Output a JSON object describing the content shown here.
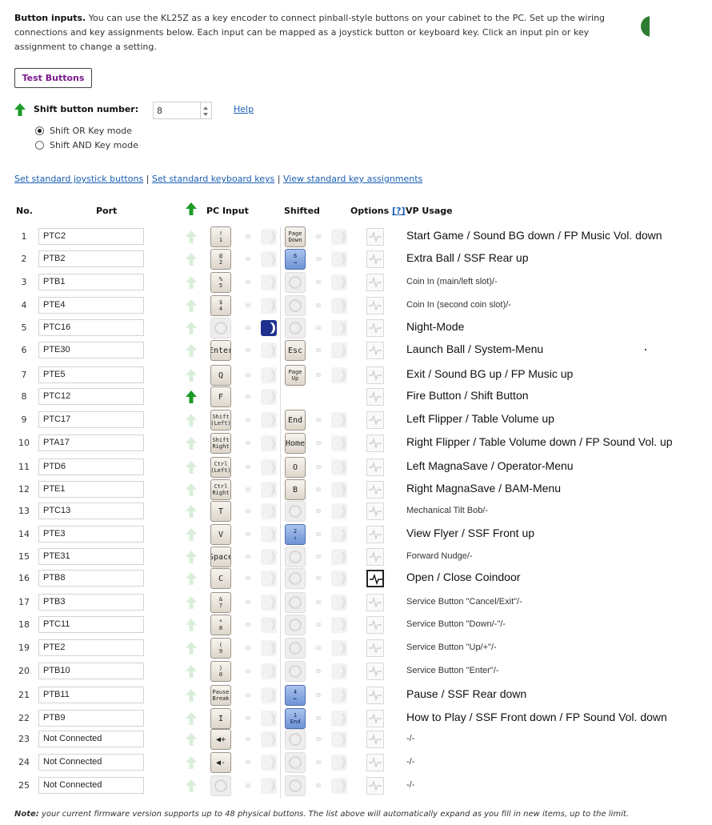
{
  "intro": {
    "lead": "Button inputs.",
    "text": "You can use the KL25Z as a key encoder to connect pinball-style buttons on your cabinet to the PC. Set up the wiring connections and key assignments below. Each input can be mapped as a joystick button or keyboard key. Click an input pin or key assignment to change a setting."
  },
  "test_button": "Test Buttons",
  "shift": {
    "label": "Shift button number:",
    "value": "8",
    "help": "Help",
    "modes": [
      {
        "label": "Shift OR Key mode",
        "selected": true
      },
      {
        "label": "Shift AND Key mode",
        "selected": false
      }
    ]
  },
  "links": {
    "joystick": "Set standard joystick buttons",
    "keyboard": "Set standard keyboard keys",
    "view": "View standard key assignments",
    "sep": " | "
  },
  "headers": {
    "no": "No.",
    "port": "Port",
    "pc_input": "PC Input",
    "shifted": "Shifted",
    "options": "Options",
    "options_help": "[?]",
    "vp_usage": "VP Usage"
  },
  "colors": {
    "shift_arrow_active": "#1d9b2a",
    "shift_arrow_inactive": "#d4ecd4",
    "link": "#1a5fb4",
    "key_blue": "#7b9edb",
    "night_mode": "#1e2f8e"
  },
  "rows": [
    {
      "no": "1",
      "port": "PTC2",
      "key": {
        "t": "!",
        "b": "1"
      },
      "shift": {
        "kind": "key",
        "t": "Page",
        "b": "Down"
      },
      "usage": "Start Game / Sound BG down / FP Music Vol. down",
      "size": "lg"
    },
    {
      "no": "2",
      "port": "PTB2",
      "key": {
        "t": "@",
        "b": "2"
      },
      "shift": {
        "kind": "blue",
        "t": "6",
        "b": "→"
      },
      "usage": "Extra Ball / SSF Rear up",
      "size": "lg"
    },
    {
      "no": "3",
      "port": "PTB1",
      "key": {
        "t": "%",
        "b": "5"
      },
      "shift": {
        "kind": "empty"
      },
      "usage": "Coin In (main/left slot)/-",
      "size": "sm"
    },
    {
      "no": "4",
      "port": "PTE4",
      "key": {
        "t": "$",
        "b": "4"
      },
      "shift": {
        "kind": "empty"
      },
      "usage": "Coin In (second coin slot)/-",
      "size": "sm"
    },
    {
      "no": "5",
      "port": "PTC16",
      "key": {
        "empty": true
      },
      "night": true,
      "shift": {
        "kind": "empty"
      },
      "usage": "Night-Mode",
      "size": "lg"
    },
    {
      "no": "6",
      "port": "PTE30",
      "key": {
        "m": "Enter"
      },
      "shift": {
        "kind": "key",
        "m": "Esc"
      },
      "usage": "Launch Ball / System-Menu",
      "size": "lg"
    },
    {
      "no": "7",
      "port": "PTE5",
      "key": {
        "m": "Q"
      },
      "shift": {
        "kind": "key",
        "t": "Page",
        "b": "Up"
      },
      "usage": "Exit / Sound BG up / FP Music up",
      "size": "lg"
    },
    {
      "no": "8",
      "port": "PTC12",
      "key": {
        "m": "F"
      },
      "shift_button": true,
      "shift": {
        "kind": "none"
      },
      "usage": "Fire Button / Shift Button",
      "size": "lg"
    },
    {
      "no": "9",
      "port": "PTC17",
      "key": {
        "t": "Shift",
        "b": "(Left)"
      },
      "shift": {
        "kind": "key",
        "m": "End"
      },
      "usage": "Left Flipper / Table Volume up",
      "size": "lg"
    },
    {
      "no": "10",
      "port": "PTA17",
      "key": {
        "t": "Shift",
        "b": "(Right)"
      },
      "shift": {
        "kind": "key",
        "m": "Home"
      },
      "usage": "Right Flipper / Table Volume down / FP Sound Vol.  up",
      "size": "lg"
    },
    {
      "no": "11",
      "port": "PTD6",
      "key": {
        "t": "Ctrl",
        "b": "(Left)"
      },
      "shift": {
        "kind": "key",
        "m": "O"
      },
      "usage": "Left MagnaSave / Operator-Menu",
      "size": "lg"
    },
    {
      "no": "12",
      "port": "PTE1",
      "key": {
        "t": "Ctrl",
        "b": "(Right)"
      },
      "shift": {
        "kind": "key",
        "m": "B"
      },
      "usage": "Right MagnaSave / BAM-Menu",
      "size": "lg"
    },
    {
      "no": "13",
      "port": "PTC13",
      "key": {
        "m": "T"
      },
      "shift": {
        "kind": "empty"
      },
      "usage": "Mechanical Tilt Bob/-",
      "size": "sm"
    },
    {
      "no": "14",
      "port": "PTE3",
      "key": {
        "m": "V"
      },
      "shift": {
        "kind": "blue",
        "t": "2",
        "b": "↓"
      },
      "usage": "View Flyer / SSF Front up",
      "size": "lg"
    },
    {
      "no": "15",
      "port": "PTE31",
      "key": {
        "m": "Space"
      },
      "shift": {
        "kind": "empty"
      },
      "usage": "Forward Nudge/-",
      "size": "sm"
    },
    {
      "no": "16",
      "port": "PTB8",
      "key": {
        "m": "C"
      },
      "option_on": true,
      "shift": {
        "kind": "empty"
      },
      "usage": "Open / Close Coindoor",
      "size": "lg"
    },
    {
      "no": "17",
      "port": "PTB3",
      "key": {
        "t": "&",
        "b": "7"
      },
      "shift": {
        "kind": "empty"
      },
      "usage": "Service Button \"Cancel/Exit\"/-",
      "size": "sm"
    },
    {
      "no": "18",
      "port": "PTC11",
      "key": {
        "t": "*",
        "b": "8"
      },
      "shift": {
        "kind": "empty"
      },
      "usage": "Service Button \"Down/-\"/-",
      "size": "sm"
    },
    {
      "no": "19",
      "port": "PTE2",
      "key": {
        "t": "(",
        "b": "9"
      },
      "shift": {
        "kind": "empty"
      },
      "usage": "Service Button \"Up/+\"/-",
      "size": "sm"
    },
    {
      "no": "20",
      "port": "PTB10",
      "key": {
        "t": ")",
        "b": "0"
      },
      "shift": {
        "kind": "empty"
      },
      "usage": "Service Button \"Enter\"/-",
      "size": "sm"
    },
    {
      "no": "21",
      "port": "PTB11",
      "key": {
        "t": "Pause",
        "b": "Break"
      },
      "shift": {
        "kind": "blue",
        "t": "4",
        "b": "←"
      },
      "usage": "Pause / SSF Rear down",
      "size": "lg"
    },
    {
      "no": "22",
      "port": "PTB9",
      "key": {
        "m": "I"
      },
      "shift": {
        "kind": "blue",
        "t": "1",
        "b": "End"
      },
      "usage": "How to Play / SSF Front down / FP Sound Vol. down",
      "size": "lg"
    },
    {
      "no": "23",
      "port": "Not Connected",
      "key": {
        "m": "◀+"
      },
      "shift": {
        "kind": "empty"
      },
      "usage": "-/-",
      "size": "sm"
    },
    {
      "no": "24",
      "port": "Not Connected",
      "key": {
        "m": "◀-"
      },
      "shift": {
        "kind": "empty"
      },
      "usage": "-/-",
      "size": "sm"
    },
    {
      "no": "25",
      "port": "Not Connected",
      "key": {
        "empty": true
      },
      "shift": {
        "kind": "empty"
      },
      "usage": "-/-",
      "size": "sm"
    }
  ],
  "note": {
    "lead": "Note:",
    "text": "your current firmware version supports up to 48 physical buttons. The list above will automatically expand as you fill in new items, up to the limit."
  }
}
